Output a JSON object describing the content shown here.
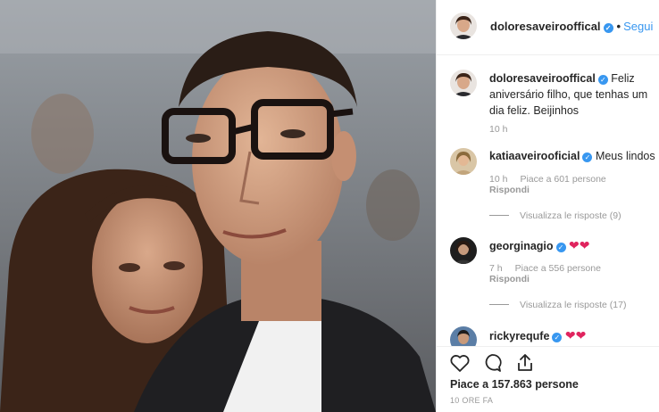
{
  "post": {
    "author": "doloresaveirooffical",
    "dot": "•",
    "follow_label": "Segui",
    "verified_glyph": "✓"
  },
  "caption": {
    "user": "doloresaveirooffical",
    "text": "Feliz aniversário filho, que tenhas um dia feliz. Beijinhos",
    "time": "10 h"
  },
  "comments": [
    {
      "user": "katiaaveirooficial",
      "text": "Meus lindos",
      "time": "10 h",
      "likes": "Piace a 601 persone",
      "reply": "Rispondi",
      "view_replies": "Visualizza le risposte (9)"
    },
    {
      "user": "georginagio",
      "text": "❤❤",
      "time": "7 h",
      "likes": "Piace a 556 persone",
      "reply": "Rispondi",
      "view_replies": "Visualizza le risposte (17)"
    },
    {
      "user": "rickyrequfe",
      "text": "❤❤"
    }
  ],
  "footer": {
    "likes": "Piace a 157.863 persone",
    "time": "10 ORE FA"
  },
  "icons": [
    "heart-icon",
    "comment-icon",
    "share-icon"
  ],
  "colors": {
    "accent": "#3897f0",
    "heart": "#e0245e",
    "muted": "#999999"
  }
}
